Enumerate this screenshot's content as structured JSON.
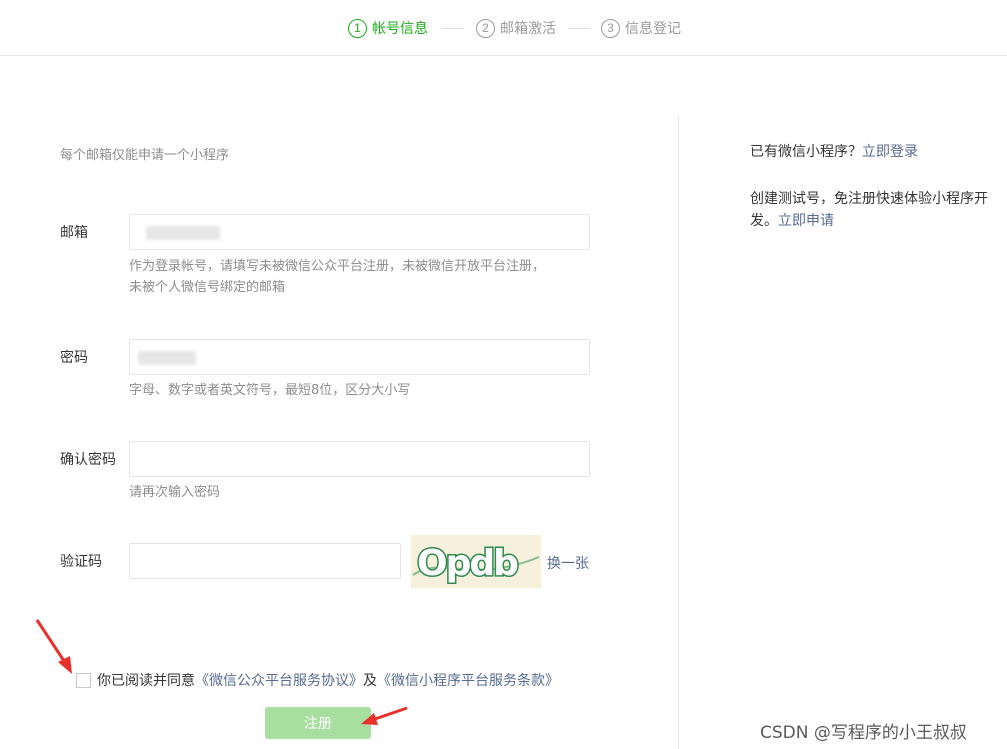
{
  "steps": [
    {
      "num": "1",
      "label": "帐号信息",
      "active": true
    },
    {
      "num": "2",
      "label": "邮箱激活",
      "active": false
    },
    {
      "num": "3",
      "label": "信息登记",
      "active": false
    }
  ],
  "form": {
    "tip": "每个邮箱仅能申请一个小程序",
    "email": {
      "label": "邮箱",
      "hint_line1": "作为登录帐号，请填写未被微信公众平台注册，未被微信开放平台注册，",
      "hint_line2": "未被个人微信号绑定的邮箱"
    },
    "password": {
      "label": "密码",
      "hint": "字母、数字或者英文符号，最短8位，区分大小写"
    },
    "confirm": {
      "label": "确认密码",
      "hint": "请再次输入密码"
    },
    "captcha": {
      "label": "验证码",
      "image_text": "Opdb",
      "refresh_label": "换一张"
    },
    "agreement": {
      "prefix": "你已阅读并同意",
      "link1": "《微信公众平台服务协议》",
      "middle": "及",
      "link2": "《微信小程序平台服务条款》"
    },
    "submit_label": "注册"
  },
  "sidebar": {
    "login_prefix": "已有微信小程序？",
    "login_link": "立即登录",
    "test_line1": "创建测试号，免注册快速体验小程序开",
    "test_line2_prefix": "发。",
    "test_link": "立即申请"
  },
  "watermark": "CSDN @写程序的小王叔叔",
  "colors": {
    "accent": "#1aad19",
    "link": "#576b95",
    "button_disabled": "#a8dfa0",
    "annotation": "#e8312a"
  }
}
